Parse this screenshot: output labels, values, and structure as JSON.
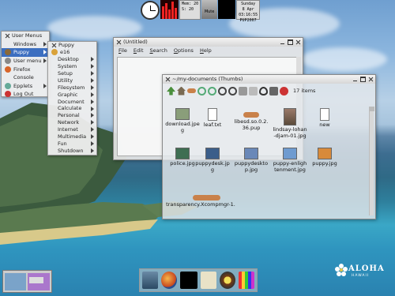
{
  "colors": {
    "accent": "#3c6fc0",
    "menu_bg": "#eeeeee",
    "window_title": "#dadada"
  },
  "top_panel": {
    "mem_label": "Mem",
    "mem_value": "20",
    "swap_label": "S",
    "swap_value": "20",
    "mute_label": "Mute",
    "clock": {
      "day": "Sunday",
      "date": "8 Apr",
      "time": "03:16:55",
      "tz": "PUP2007"
    }
  },
  "left_menu": [
    {
      "label": "User Menus",
      "icon": "close-icon",
      "arrow": false
    },
    {
      "label": "Windows",
      "icon": "",
      "arrow": true
    },
    {
      "label": "Puppy",
      "icon": "puppy-icon",
      "arrow": true,
      "selected": true
    },
    {
      "label": "User menu",
      "icon": "user-icon",
      "arrow": true
    },
    {
      "label": "Firefox",
      "icon": "firefox-icon",
      "arrow": false
    },
    {
      "label": "Console",
      "icon": "",
      "arrow": false
    },
    {
      "label": "Epplets",
      "icon": "epplets-icon",
      "arrow": true
    },
    {
      "label": "Log Out",
      "icon": "logout-icon",
      "arrow": false
    }
  ],
  "puppy_menu": [
    {
      "label": "Puppy",
      "arrow": false,
      "close": true
    },
    {
      "label": "e16",
      "arrow": false,
      "icon": true
    },
    {
      "label": "Desktop",
      "arrow": true
    },
    {
      "label": "System",
      "arrow": true
    },
    {
      "label": "Setup",
      "arrow": true
    },
    {
      "label": "Utility",
      "arrow": true
    },
    {
      "label": "Filesystem",
      "arrow": true
    },
    {
      "label": "Graphic",
      "arrow": true
    },
    {
      "label": "Document",
      "arrow": true
    },
    {
      "label": "Calculate",
      "arrow": true
    },
    {
      "label": "Personal",
      "arrow": true
    },
    {
      "label": "Network",
      "arrow": true
    },
    {
      "label": "Internet",
      "arrow": true
    },
    {
      "label": "Multimedia",
      "arrow": true
    },
    {
      "label": "Fun",
      "arrow": true
    },
    {
      "label": "Shutdown",
      "arrow": true
    }
  ],
  "editor": {
    "title": "(Untitled)",
    "menus": [
      "File",
      "Edit",
      "Search",
      "Options",
      "Help"
    ]
  },
  "filer": {
    "title": "~/my-documents (Thumbs)",
    "items_count": "17 items",
    "files": [
      {
        "name": "download.jpeg",
        "kind": "image"
      },
      {
        "name": "leaf.txt",
        "kind": "text"
      },
      {
        "name": "libesd.so.0.2.36.pup",
        "kind": "bone"
      },
      {
        "name": "lindsay-lohan-djam-01.jpg",
        "kind": "photo"
      },
      {
        "name": "new",
        "kind": "text"
      },
      {
        "name": "police.jpg",
        "kind": "image"
      },
      {
        "name": "puppydesk.jpg",
        "kind": "image"
      },
      {
        "name": "puppydesktop.jpg",
        "kind": "image"
      },
      {
        "name": "puppy-enlightenment.jpg",
        "kind": "image"
      },
      {
        "name": "puppy.jpg",
        "kind": "image"
      },
      {
        "name": "transparency.Xcompmgr-1.",
        "kind": "bone"
      },
      {
        "name": "",
        "kind": "bone"
      }
    ]
  },
  "dock": [
    "screen-icon",
    "firefox-icon",
    "terminal-icon",
    "notes-icon",
    "media-icon",
    "paint-icon"
  ],
  "brand": {
    "aloha": "ALOHA",
    "hawaii": "HAWAII"
  }
}
